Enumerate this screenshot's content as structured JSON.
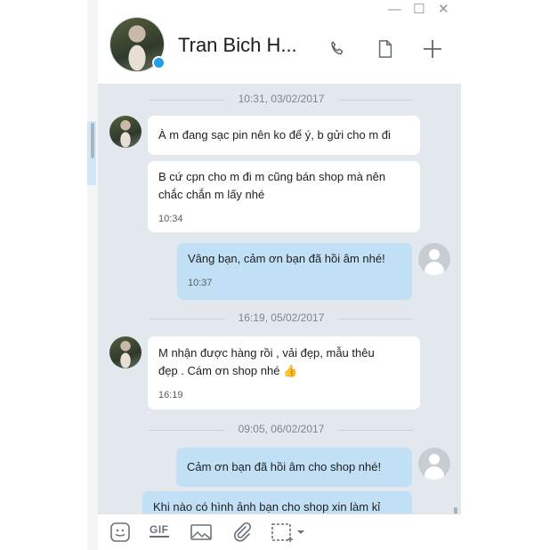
{
  "window": {
    "controls": [
      "—",
      "☐",
      "✕"
    ]
  },
  "header": {
    "contact_name": "Tran Bich H...",
    "status_color": "#1e9fe8",
    "icons": [
      "phone-icon",
      "document-icon",
      "plus-icon"
    ]
  },
  "messages": {
    "d1": "10:31, 03/02/2017",
    "m1": "À m đang sạc pin nên ko để ý, b gửi cho m đi",
    "m2": "B cứ cpn cho m đi m cũng bán shop mà nên\nchắc chắn m lấy nhé",
    "m2_time": "10:34",
    "m3": "Vâng bạn, cảm ơn bạn đã hồi âm nhé!",
    "m3_time": "10:37",
    "d2": "16:19, 05/02/2017",
    "m4": "M nhận được hàng rồi , vải đẹp, mẫu thêu\nđẹp . Cám ơn shop nhé 👍",
    "m4_time": "16:19",
    "d3": "09:05, 06/02/2017",
    "m5": "Cảm ơn bạn đã hồi âm cho shop nhé!",
    "m6": "Khi nào có hình ảnh bạn cho shop xin làm kỉ"
  },
  "toolbar": {
    "gif_label": "GIF",
    "icons": [
      "sticker-icon",
      "gif-icon",
      "image-icon",
      "attachment-icon",
      "screenshot-icon"
    ]
  },
  "colors": {
    "chat_bg": "#e3e8ee",
    "outgoing_bubble": "#c2e0f5",
    "incoming_bubble": "#ffffff"
  }
}
